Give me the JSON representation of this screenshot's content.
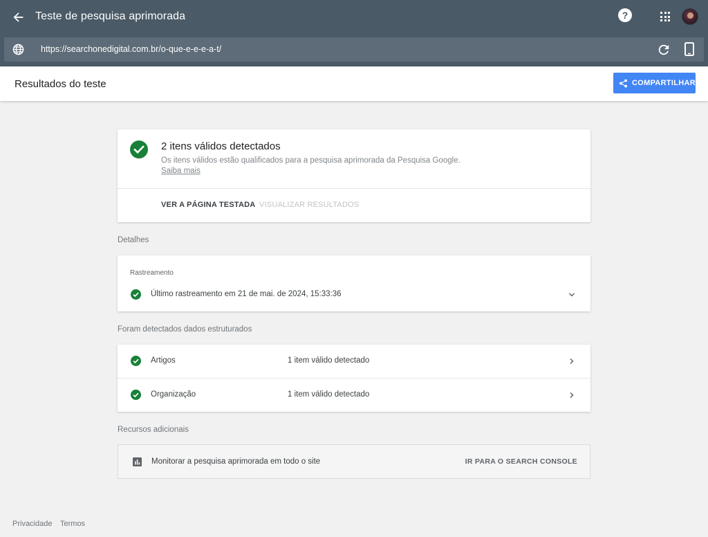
{
  "header": {
    "title": "Teste de pesquisa aprimorada",
    "url": "https://searchonedigital.com.br/o-que-e-e-e-a-t/",
    "help_symbol": "?",
    "icons": [
      "back-arrow-icon",
      "help-icon",
      "apps-grid-icon",
      "avatar",
      "globe-icon",
      "reload-icon",
      "mobile-device-icon"
    ]
  },
  "results_bar": {
    "title": "Resultados do teste",
    "share_label": "COMPARTILHAR"
  },
  "summary": {
    "title": "2 itens válidos detectados",
    "description": "Os itens válidos estão qualificados para a pesquisa aprimorada da Pesquisa Google.",
    "learn_more": "Saiba mais",
    "view_tested_page": "VER A PÁGINA TESTADA",
    "view_results": "VISUALIZAR RESULTADOS"
  },
  "details": {
    "section_label": "Detalhes",
    "crawl_label": "Rastreamento",
    "crawl_text": "Último rastreamento em 21 de mai. de 2024, 15:33:36"
  },
  "structured": {
    "section_label": "Foram detectados dados estruturados",
    "rows": [
      {
        "name": "Artigos",
        "status": "1 item válido detectado"
      },
      {
        "name": "Organização",
        "status": "1 item válido detectado"
      }
    ]
  },
  "resources": {
    "section_label": "Recursos adicionais",
    "text": "Monitorar a pesquisa aprimorada em todo o site",
    "link": "IR PARA O SEARCH CONSOLE"
  },
  "footer": {
    "privacy": "Privacidade",
    "terms": "Termos"
  },
  "colors": {
    "header_bg": "#4a5a66",
    "url_bar_bg": "#5d6c78",
    "accent_blue": "#4285f4",
    "success_green": "#188038"
  }
}
